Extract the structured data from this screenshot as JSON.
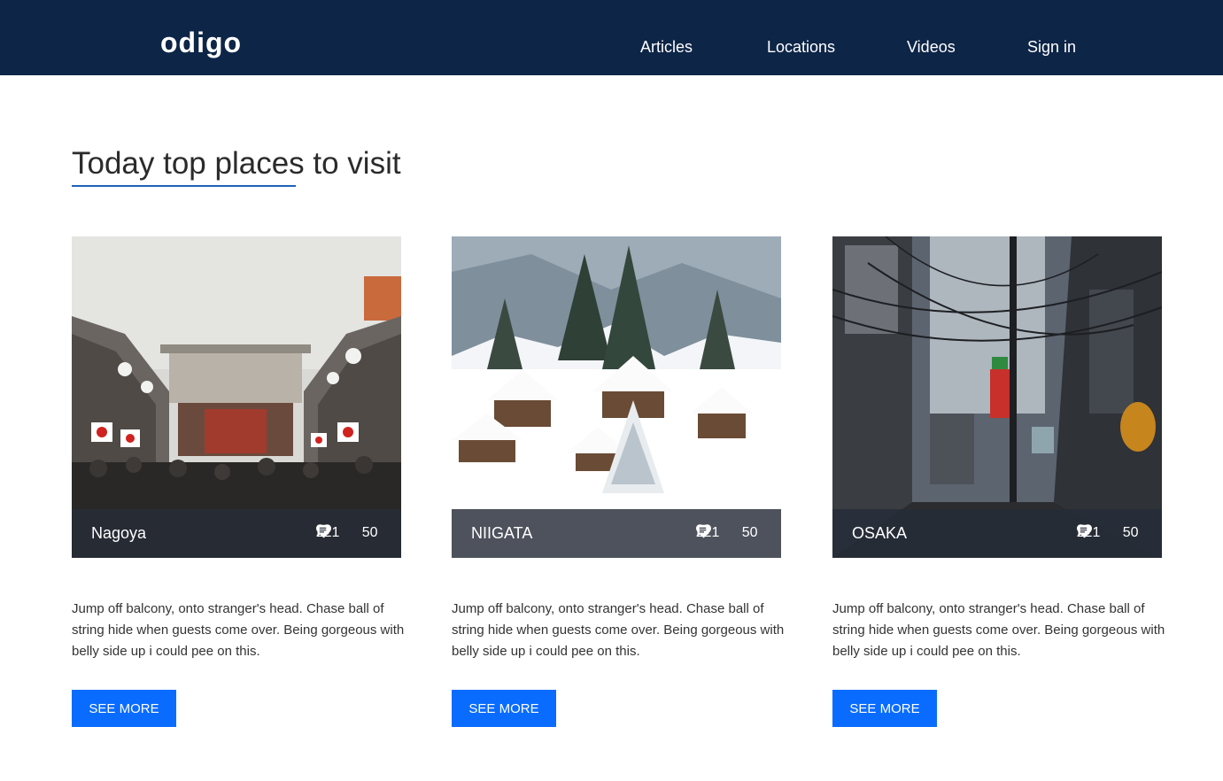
{
  "header": {
    "logo": "odigo",
    "nav": [
      {
        "label": "Articles"
      },
      {
        "label": "Locations"
      },
      {
        "label": "Videos"
      },
      {
        "label": "Sign in"
      }
    ]
  },
  "colors": {
    "header_bg": "#0d2547",
    "accent_underline": "#1e63b8",
    "button_bg": "#0a6cff"
  },
  "section": {
    "title": "Today top places to visit"
  },
  "cards": [
    {
      "name": "Nagoya",
      "likes": "221",
      "comments": "50",
      "description": "Jump off balcony, onto stranger's head. Chase ball of string hide when guests come over. Being gorgeous with belly side up i could pee on this.",
      "button": "SEE MORE",
      "like_icon": "heart-icon",
      "comment_icon": "comment-icon"
    },
    {
      "name": "NIIGATA",
      "likes": "221",
      "comments": "50",
      "description": "Jump off balcony, onto stranger's head. Chase ball of string hide when guests come over. Being gorgeous with belly side up i could pee on this.",
      "button": "SEE MORE",
      "like_icon": "heart-icon",
      "comment_icon": "comment-icon"
    },
    {
      "name": "OSAKA",
      "likes": "221",
      "comments": "50",
      "description": "Jump off balcony, onto stranger's head. Chase ball of string hide when guests come over. Being gorgeous with belly side up i could pee on this.",
      "button": "SEE MORE",
      "like_icon": "heart-icon",
      "comment_icon": "comment-icon"
    }
  ]
}
